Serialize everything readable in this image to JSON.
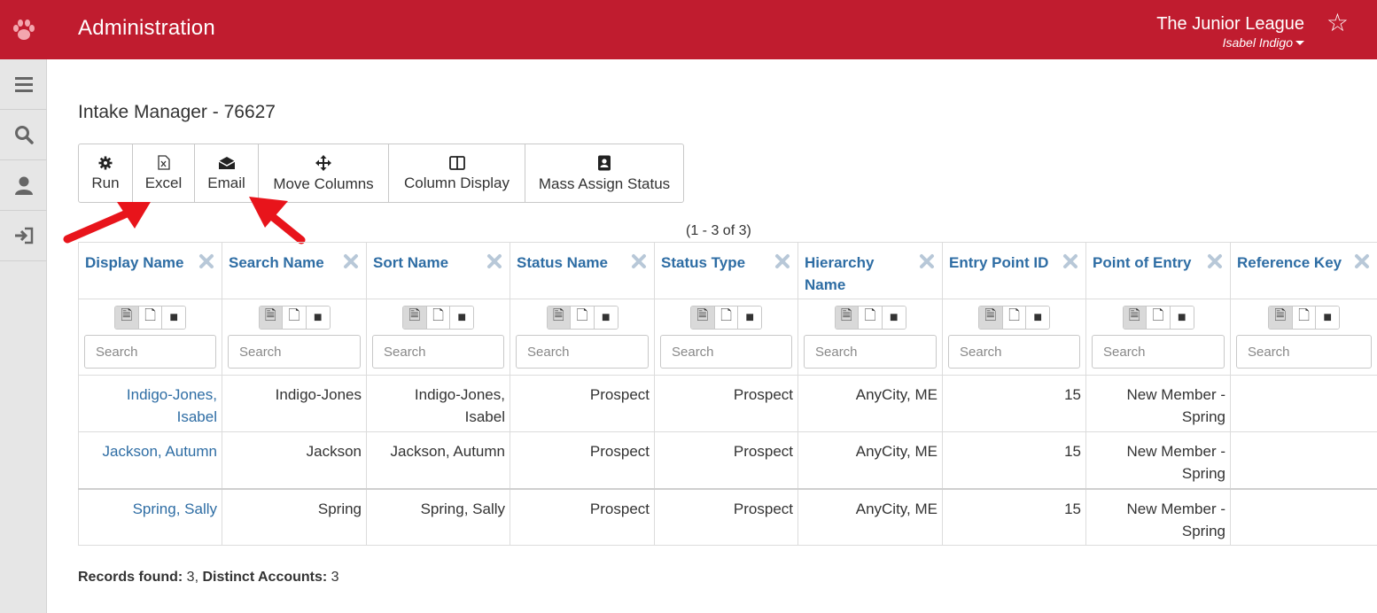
{
  "header": {
    "title": "Administration",
    "org_name": "The Junior League",
    "user_name": "Isabel Indigo"
  },
  "icons": {
    "logo": "paw-icon",
    "favorite": "star-icon",
    "rail": [
      "menu-icon",
      "search-icon",
      "user-icon",
      "sign-in-icon"
    ]
  },
  "colors": {
    "brand": "#c01c2f",
    "link": "#2e6da4",
    "annotation_arrow": "#e8141b"
  },
  "page": {
    "title": "Intake Manager - 76627"
  },
  "toolbar": {
    "run": "Run",
    "excel": "Excel",
    "email": "Email",
    "move_columns": "Move Columns",
    "column_display": "Column Display",
    "mass_assign_status": "Mass Assign Status"
  },
  "pager": "(1 - 3 of 3)",
  "grid": {
    "search_placeholder": "Search",
    "columns": [
      "Display Name",
      "Search Name",
      "Sort Name",
      "Status Name",
      "Status Type",
      "Hierarchy Name",
      "Entry Point ID",
      "Point of Entry",
      "Reference Key"
    ],
    "rows": [
      {
        "display_name": "Indigo-Jones, Isabel",
        "search_name": "Indigo-Jones",
        "sort_name": "Indigo-Jones, Isabel",
        "status_name": "Prospect",
        "status_type": "Prospect",
        "hierarchy_name": "AnyCity, ME",
        "entry_point_id": "15",
        "point_of_entry": "New Member - Spring",
        "reference_key": ""
      },
      {
        "display_name": "Jackson, Autumn",
        "search_name": "Jackson",
        "sort_name": "Jackson, Autumn",
        "status_name": "Prospect",
        "status_type": "Prospect",
        "hierarchy_name": "AnyCity, ME",
        "entry_point_id": "15",
        "point_of_entry": "New Member - Spring",
        "reference_key": ""
      },
      {
        "display_name": "Spring, Sally",
        "search_name": "Spring",
        "sort_name": "Spring, Sally",
        "status_name": "Prospect",
        "status_type": "Prospect",
        "hierarchy_name": "AnyCity, ME",
        "entry_point_id": "15",
        "point_of_entry": "New Member - Spring",
        "reference_key": ""
      }
    ]
  },
  "summary": {
    "records_label": "Records found:",
    "records_value": "3",
    "accounts_label": "Distinct Accounts:",
    "accounts_value": "3"
  }
}
